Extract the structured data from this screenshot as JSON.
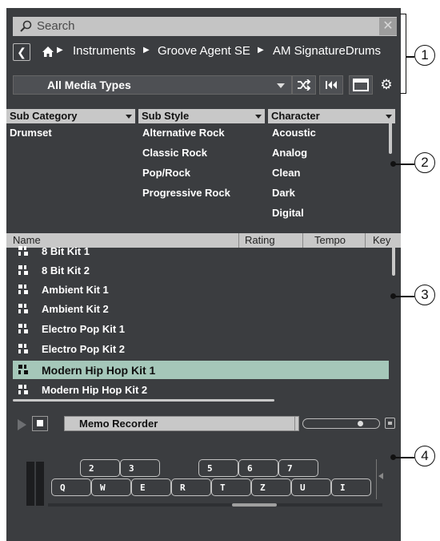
{
  "search": {
    "placeholder": "Search"
  },
  "breadcrumb": {
    "items": [
      "Instruments",
      "Groove Agent SE",
      "AM SignatureDrums"
    ]
  },
  "media_filter": {
    "selected": "All Media Types"
  },
  "filters": {
    "sub_category": {
      "header": "Sub Category",
      "items": [
        "Drumset"
      ]
    },
    "sub_style": {
      "header": "Sub Style",
      "items": [
        "Alternative Rock",
        "Classic Rock",
        "Pop/Rock",
        "Progressive Rock"
      ]
    },
    "character": {
      "header": "Character",
      "items": [
        "Acoustic",
        "Analog",
        "Clean",
        "Dark",
        "Digital"
      ]
    }
  },
  "results": {
    "columns": [
      "Name",
      "Rating",
      "Tempo",
      "Key"
    ],
    "rows": [
      "8 Bit Kit 1",
      "8 Bit Kit 2",
      "Ambient Kit 1",
      "Ambient Kit 2",
      "Electro Pop Kit 1",
      "Electro Pop Kit 2",
      "Modern Hip Hop Kit 1",
      "Modern Hip Hop Kit 2"
    ],
    "selected": "Modern Hip Hop Kit 1"
  },
  "player": {
    "label": "Memo Recorder"
  },
  "keyboard": {
    "upper": [
      "2",
      "3",
      "5",
      "6",
      "7"
    ],
    "lower": [
      "Q",
      "W",
      "E",
      "R",
      "T",
      "Z",
      "U",
      "I"
    ]
  },
  "callouts": [
    "1",
    "2",
    "3",
    "4"
  ],
  "colors": {
    "panel": "#3b3d40",
    "selection": "#a5c7b9",
    "header": "#c8c8c8"
  }
}
